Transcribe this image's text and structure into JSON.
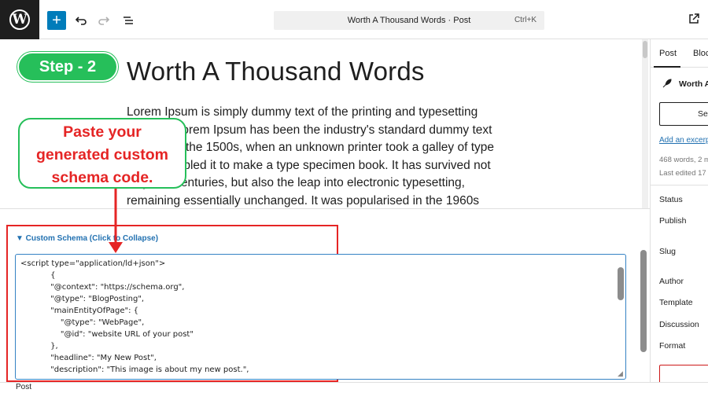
{
  "toolbar": {
    "logo_letter": "W",
    "add_symbol": "+",
    "command_title": "Worth A Thousand Words · Post",
    "command_shortcut": "Ctrl+K"
  },
  "icons": {
    "logo": "wordpress-logo-icon",
    "add": "plus-icon",
    "undo": "undo-icon",
    "redo": "redo-icon",
    "list_view": "list-view-icon",
    "view_post": "external-link-icon",
    "post_type": "feather-pen-icon"
  },
  "editor": {
    "title": "Worth A Thousand Words",
    "paragraph": [
      "Lorem Ipsum is simply dummy text of the printing and typesetting",
      "industry. Lorem Ipsum has been the industry's standard dummy text",
      "ever since the 1500s, when an unknown printer took a galley of type",
      "and scrambled it to make a type specimen book. It has survived not",
      "only five centuries, but also the leap into electronic typesetting,",
      "remaining essentially unchanged. It was popularised in the 1960s"
    ]
  },
  "annotation": {
    "step": "Step - 2",
    "callout": [
      "Paste your",
      "generated custom",
      "schema code."
    ],
    "colors": {
      "green": "#26bf5a",
      "red": "#e52525"
    }
  },
  "metabox": {
    "header": "▼ Custom Schema (Click to Collapse)",
    "code_lines": [
      "<script type=\"application/ld+json\">",
      "            {",
      "            \"@context\": \"https://schema.org\",",
      "            \"@type\": \"BlogPosting\",",
      "            \"mainEntityOfPage\": {",
      "                \"@type\": \"WebPage\",",
      "                \"@id\": \"website URL of your post\"",
      "            },",
      "            \"headline\": \"My New Post\",",
      "            \"description\": \"This image is about my new post.\","
    ]
  },
  "statusbar": {
    "label": "Post"
  },
  "sidebar": {
    "tab_post": "Post",
    "tab_block": "Block",
    "post_title": "Worth A",
    "set_button": "Set",
    "excerpt_link": "Add an excerp",
    "words": "468 words, 2 m",
    "edited": "Last edited 17",
    "fields": [
      "Status",
      "Publish",
      "Slug",
      "Author",
      "Template",
      "Discussion",
      "Format"
    ]
  }
}
